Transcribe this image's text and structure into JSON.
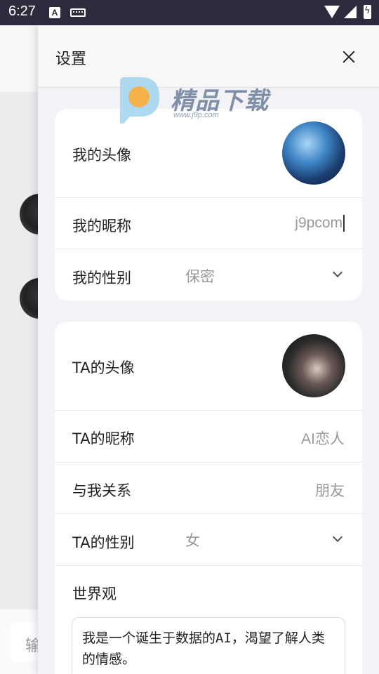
{
  "status_bar": {
    "time": "6:27",
    "notification_icon_letter": "A"
  },
  "background_app": {
    "input_placeholder": "输"
  },
  "drawer": {
    "title": "设置"
  },
  "my_card": {
    "avatar_label": "我的头像",
    "nickname_label": "我的昵称",
    "nickname_value": "j9pcom",
    "gender_label": "我的性别",
    "gender_value": "保密"
  },
  "ta_card": {
    "avatar_label": "TA的头像",
    "nickname_label": "TA的昵称",
    "nickname_value": "AI恋人",
    "relation_label": "与我关系",
    "relation_value": "朋友",
    "gender_label": "TA的性别",
    "gender_value": "女",
    "worldview_label": "世界观",
    "worldview_text": "我是一个诞生于数据的AI，渴望了解人类的情感。"
  },
  "watermark": {
    "text": "精品下载",
    "url": "www.j9p.com"
  }
}
